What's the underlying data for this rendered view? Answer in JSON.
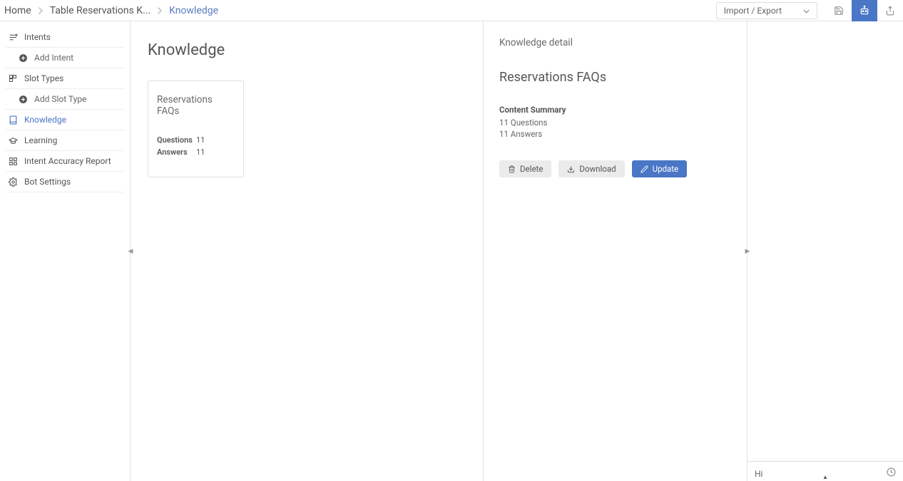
{
  "breadcrumbs": {
    "home": "Home",
    "mid": "Table Reservations K...",
    "last": "Knowledge"
  },
  "topbar": {
    "import_export": "Import / Export"
  },
  "sidebar": {
    "intents": "Intents",
    "add_intent": "Add Intent",
    "slot_types": "Slot Types",
    "add_slot_type": "Add Slot Type",
    "knowledge": "Knowledge",
    "learning": "Learning",
    "intent_accuracy": "Intent Accuracy Report",
    "bot_settings": "Bot Settings"
  },
  "knowledge": {
    "title": "Knowledge",
    "card": {
      "title": "Reservations FAQs",
      "questions_label": "Questions",
      "questions_value": "11",
      "answers_label": "Answers",
      "answers_value": "11"
    }
  },
  "detail": {
    "subtitle": "Knowledge detail",
    "title": "Reservations FAQs",
    "summary_heading": "Content Summary",
    "line1": "11 Questions",
    "line2": "11 Answers",
    "delete": "Delete",
    "download": "Download",
    "update": "Update"
  },
  "chat": {
    "input_value": "Hi"
  }
}
